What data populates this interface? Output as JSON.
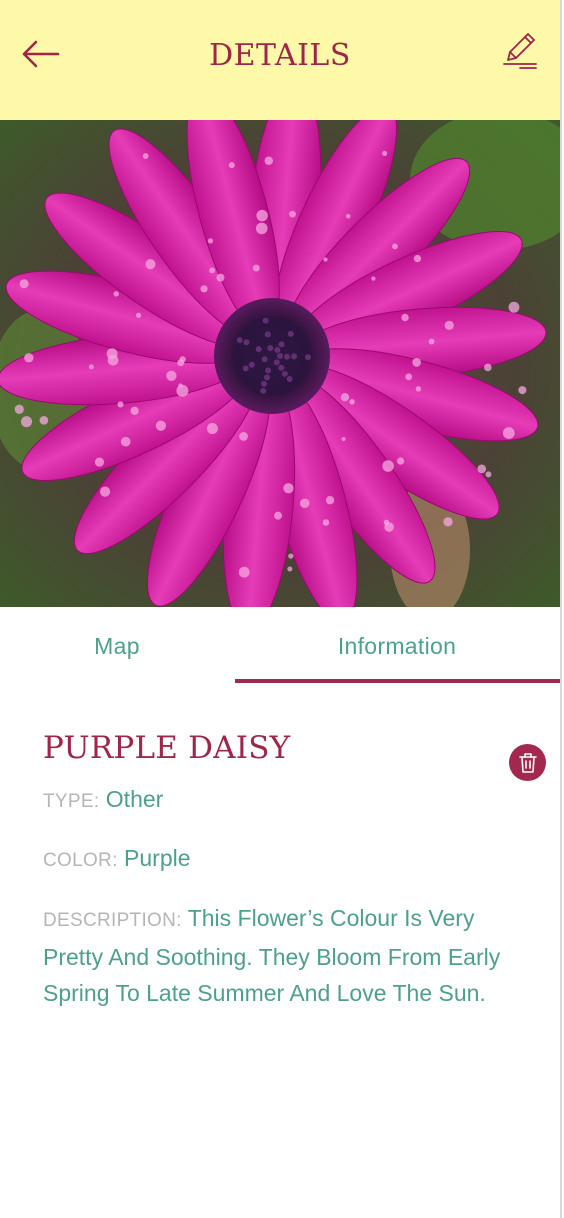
{
  "header": {
    "title": "DETAILS",
    "back_icon": "arrow-left-icon",
    "edit_icon": "pencil-icon"
  },
  "photo": {
    "subject": "purple-daisy",
    "camera_icon": "camera-icon"
  },
  "tabs": [
    {
      "label": "Map",
      "active": false
    },
    {
      "label": "Information",
      "active": true
    }
  ],
  "plant": {
    "name": "PURPLE DAISY",
    "delete_icon": "trash-icon",
    "type_label": "TYPE:",
    "type_value": "Other",
    "color_label": "COLOR:",
    "color_value": "Purple",
    "description_label": "DESCRIPTION:",
    "description_value": "This Flower’s Colour Is Very Pretty And Soothing. They Bloom From Early Spring To Late Summer And Love The Sun."
  },
  "colors": {
    "header_bg": "#fdf9a9",
    "accent": "#9c2748",
    "teal_text": "#4e9f8c",
    "label_gray": "#b5b5b5",
    "camera_button": "#c7304f"
  }
}
